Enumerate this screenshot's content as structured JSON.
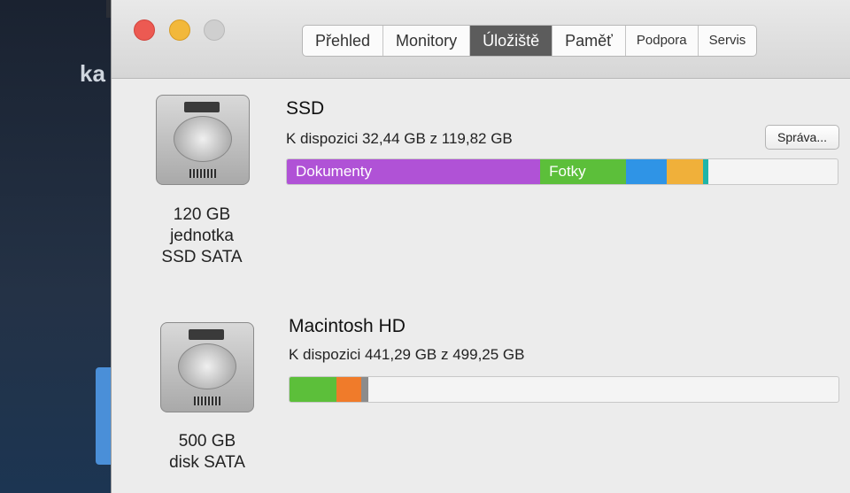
{
  "desktop": {
    "partial_text": "ka"
  },
  "window": {
    "tabs": [
      {
        "label": "Přehled",
        "active": false
      },
      {
        "label": "Monitory",
        "active": false
      },
      {
        "label": "Úložiště",
        "active": true
      },
      {
        "label": "Paměť",
        "active": false
      },
      {
        "label": "Podpora",
        "active": false
      },
      {
        "label": "Servis",
        "active": false
      }
    ]
  },
  "drives": [
    {
      "icon": "hard-drive-icon",
      "caption_lines": [
        "120 GB",
        "jednotka",
        "SSD SATA"
      ],
      "volume_name": "SSD",
      "availability": "K dispozici 32,44 GB z 119,82 GB",
      "manage_button": "Správa...",
      "segments": [
        {
          "label": "Dokumenty",
          "color": "#b052d6",
          "fraction": 0.46
        },
        {
          "label": "Fotky",
          "color": "#5cbf3a",
          "fraction": 0.155
        },
        {
          "label": "",
          "color": "#2f94e6",
          "fraction": 0.075
        },
        {
          "label": "",
          "color": "#f0b03a",
          "fraction": 0.065
        },
        {
          "label": "",
          "color": "#1fb5a8",
          "fraction": 0.01
        }
      ]
    },
    {
      "icon": "hard-drive-icon",
      "caption_lines": [
        "500 GB",
        "disk SATA"
      ],
      "volume_name": "Macintosh HD",
      "availability": "K dispozici 441,29 GB z 499,25 GB",
      "segments": [
        {
          "label": "",
          "color": "#5cbf3a",
          "fraction": 0.085
        },
        {
          "label": "",
          "color": "#f07b2a",
          "fraction": 0.045
        },
        {
          "label": "",
          "color": "#8c8c8c",
          "fraction": 0.014
        }
      ]
    }
  ]
}
